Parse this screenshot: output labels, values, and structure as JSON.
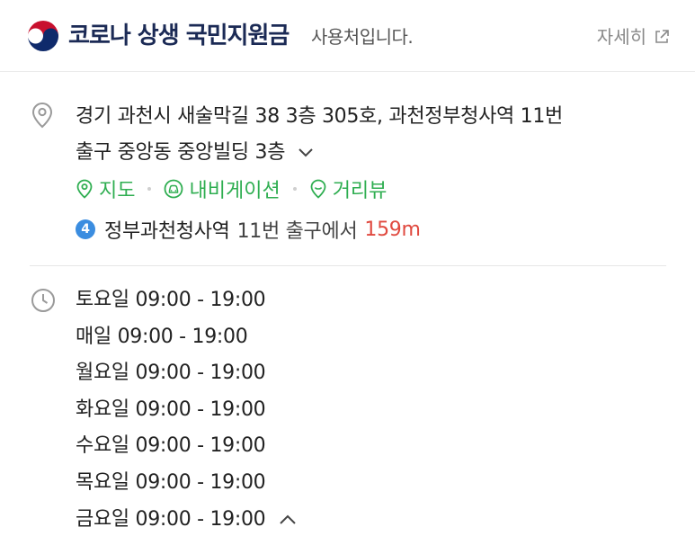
{
  "header": {
    "title": "코로나 상생 국민지원금",
    "subtitle": "사용처입니다.",
    "detail_label": "자세히",
    "logo_icon": "korea-government-emblem",
    "title_color": "#1b2a55"
  },
  "address": {
    "line1": "경기 과천시 새술막길 38 3층 305호, 과천정부청사역 11번",
    "line2": "출구 중앙동 중앙빌딩 3층",
    "icon": "map-pin-icon",
    "expand_icon": "chevron-down-icon"
  },
  "actions": {
    "color": "#2fae51",
    "items": [
      {
        "label": "지도",
        "icon": "map-pin-icon"
      },
      {
        "label": "내비게이션",
        "icon": "car-icon"
      },
      {
        "label": "거리뷰",
        "icon": "street-view-pin-icon"
      }
    ]
  },
  "subway": {
    "line_number": "4",
    "line_color": "#3b8de0",
    "station": "정부과천청사역",
    "exit_text": "11번 출구에서",
    "distance": "159m",
    "distance_color": "#e0493f"
  },
  "hours": {
    "icon": "clock-icon",
    "collapse_icon": "chevron-up-icon",
    "items": [
      "토요일 09:00 - 19:00",
      "매일 09:00 - 19:00",
      "월요일 09:00 - 19:00",
      "화요일 09:00 - 19:00",
      "수요일 09:00 - 19:00",
      "목요일 09:00 - 19:00",
      "금요일 09:00 - 19:00"
    ]
  }
}
